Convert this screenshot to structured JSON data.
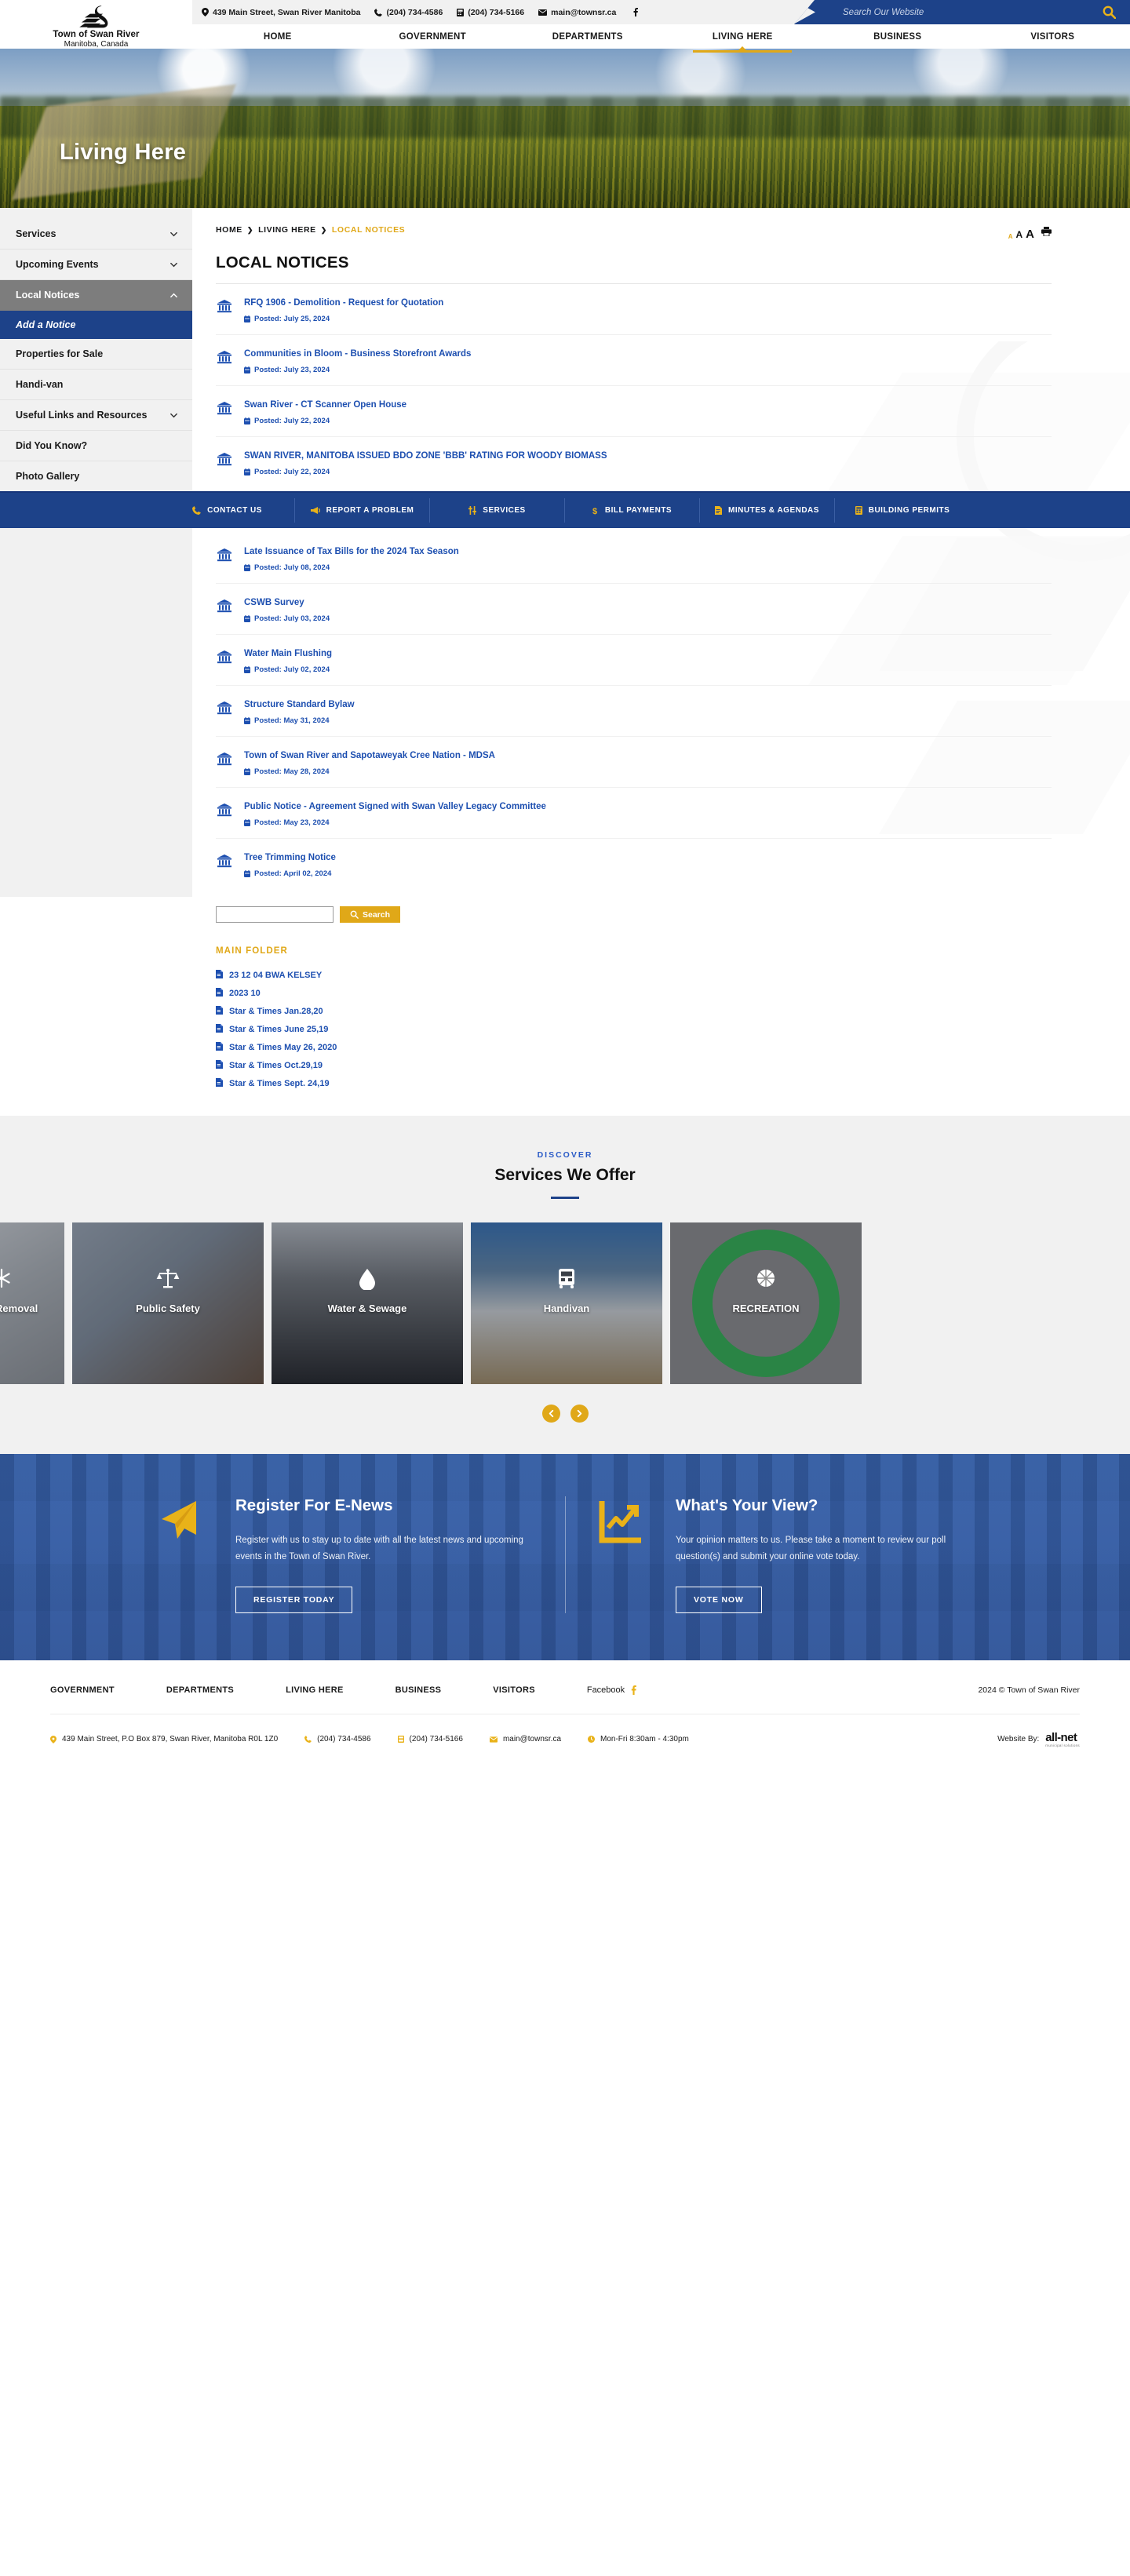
{
  "site": {
    "logo_line1": "Town of Swan River",
    "logo_line2": "Manitoba, Canada",
    "logo_icon": "swan-logo-icon"
  },
  "topbar": {
    "address": "439 Main Street, Swan River Manitoba",
    "phone": "(204) 734-4586",
    "fax": "(204) 734-5166",
    "email": "main@townsr.ca",
    "facebook_icon": "facebook-icon",
    "search_placeholder": "Search Our Website",
    "search_value": "",
    "search_icon": "search-icon"
  },
  "nav": {
    "items": [
      {
        "label": "HOME",
        "active": false
      },
      {
        "label": "GOVERNMENT",
        "active": false
      },
      {
        "label": "DEPARTMENTS",
        "active": false
      },
      {
        "label": "LIVING HERE",
        "active": true
      },
      {
        "label": "BUSINESS",
        "active": false
      },
      {
        "label": "VISITORS",
        "active": false
      }
    ]
  },
  "hero": {
    "title": "Living Here"
  },
  "sidebar": {
    "items": [
      {
        "label": "Services",
        "chevron": "chevron-down-icon",
        "state": "normal"
      },
      {
        "label": "Upcoming Events",
        "chevron": "chevron-down-icon",
        "state": "normal"
      },
      {
        "label": "Local Notices",
        "chevron": "chevron-up-icon",
        "state": "current"
      },
      {
        "label": "Add a Notice",
        "state": "sub"
      },
      {
        "label": "Properties for Sale",
        "state": "normal"
      },
      {
        "label": "Handi-van",
        "state": "normal"
      },
      {
        "label": "Useful Links and Resources",
        "chevron": "chevron-down-icon",
        "state": "normal"
      },
      {
        "label": "Did You Know?",
        "state": "normal"
      },
      {
        "label": "Photo Gallery",
        "state": "normal"
      }
    ]
  },
  "breadcrumb": {
    "home": "HOME",
    "section": "LIVING HERE",
    "current": "LOCAL NOTICES"
  },
  "tools": {
    "a_small": "A",
    "a_medium": "A",
    "a_large": "A",
    "print_icon": "printer-icon"
  },
  "page": {
    "title": "LOCAL NOTICES"
  },
  "notices": [
    {
      "title": "RFQ 1906 - Demolition - Request for Quotation",
      "date": "Posted: July 25, 2024"
    },
    {
      "title": "Communities in Bloom - Business Storefront Awards",
      "date": "Posted: July 23, 2024"
    },
    {
      "title": "Swan River - CT Scanner Open House",
      "date": "Posted: July 22, 2024"
    },
    {
      "title": "SWAN RIVER, MANITOBA ISSUED BDO ZONE 'BBB' RATING FOR WOODY BIOMASS",
      "date": "Posted: July 22, 2024"
    },
    {
      "title": "Late Issuance of Tax Bills for the 2024 Tax Season",
      "date": "Posted: July 08, 2024"
    },
    {
      "title": "CSWB Survey",
      "date": "Posted: July 03, 2024"
    },
    {
      "title": "Water Main Flushing",
      "date": "Posted: July 02, 2024"
    },
    {
      "title": "Structure Standard Bylaw",
      "date": "Posted: May 31, 2024"
    },
    {
      "title": "Town of Swan River and Sapotaweyak Cree Nation - MDSA",
      "date": "Posted: May 28, 2024"
    },
    {
      "title": "Public Notice - Agreement Signed with Swan Valley Legacy Committee",
      "date": "Posted: May 23, 2024"
    },
    {
      "title": "Tree Trimming Notice",
      "date": "Posted: April 02, 2024"
    }
  ],
  "quicklinks": [
    {
      "label": "CONTACT US",
      "icon": "phone-icon"
    },
    {
      "label": "REPORT A PROBLEM",
      "icon": "megaphone-icon"
    },
    {
      "label": "SERVICES",
      "icon": "sliders-icon"
    },
    {
      "label": "BILL PAYMENTS",
      "icon": "dollar-icon"
    },
    {
      "label": "MINUTES & AGENDAS",
      "icon": "document-icon"
    },
    {
      "label": "BUILDING PERMITS",
      "icon": "calculator-icon"
    }
  ],
  "filesearch": {
    "value": "",
    "placeholder": "",
    "button_label": "Search",
    "button_icon": "search-icon",
    "folder_heading": "MAIN FOLDER",
    "files": [
      "23 12 04 BWA KELSEY",
      "2023 10",
      "Star & Times Jan.28,20",
      "Star & Times June 25,19",
      "Star & Times May 26, 2020",
      "Star & Times Oct.29,19",
      "Star & Times Sept. 24,19"
    ]
  },
  "services": {
    "eyebrow": "DISCOVER",
    "heading": "Services We Offer",
    "prev_icon": "chevron-left-icon",
    "next_icon": "chevron-right-icon",
    "cards": [
      {
        "label": "Snow Removal",
        "icon": "snowflake-icon",
        "bg": "bg-snow",
        "clip": "first"
      },
      {
        "label": "Public Safety",
        "icon": "scales-icon",
        "bg": "bg-safety",
        "clip": ""
      },
      {
        "label": "Water & Sewage",
        "icon": "water-drop-icon",
        "bg": "bg-water",
        "clip": ""
      },
      {
        "label": "Handivan",
        "icon": "bus-icon",
        "bg": "bg-van",
        "clip": ""
      },
      {
        "label": "RECREATION",
        "icon": "recreation-icon",
        "bg": "bg-rec",
        "clip": "last"
      }
    ]
  },
  "cta": {
    "enews": {
      "icon": "paper-plane-icon",
      "heading": "Register For E-News",
      "body": "Register with us to stay up to date with all the latest news and upcoming events in the Town of Swan River.",
      "button": "REGISTER TODAY"
    },
    "poll": {
      "icon": "chart-line-icon",
      "heading": "What's Your View?",
      "body": "Your opinion matters to us. Please take a moment to review our poll question(s) and submit your online vote today.",
      "button": "VOTE NOW"
    }
  },
  "footer": {
    "links": [
      "GOVERNMENT",
      "DEPARTMENTS",
      "LIVING HERE",
      "BUSINESS",
      "VISITORS"
    ],
    "facebook_label": "Facebook",
    "facebook_icon": "facebook-icon",
    "copyright": "2024 © Town of Swan River",
    "contact": [
      {
        "icon": "location-icon",
        "text": "439 Main Street, P.O Box 879, Swan River, Manitoba R0L 1Z0"
      },
      {
        "icon": "phone-icon",
        "text": "(204) 734-4586"
      },
      {
        "icon": "fax-icon",
        "text": "(204) 734-5166"
      },
      {
        "icon": "mail-icon",
        "text": "main@townsr.ca"
      },
      {
        "icon": "clock-icon",
        "text": "Mon-Fri 8:30am - 4:30pm"
      }
    ],
    "website_by_label": "Website By:",
    "vendor": "all-net",
    "vendor_sub": "municipal solutions"
  }
}
